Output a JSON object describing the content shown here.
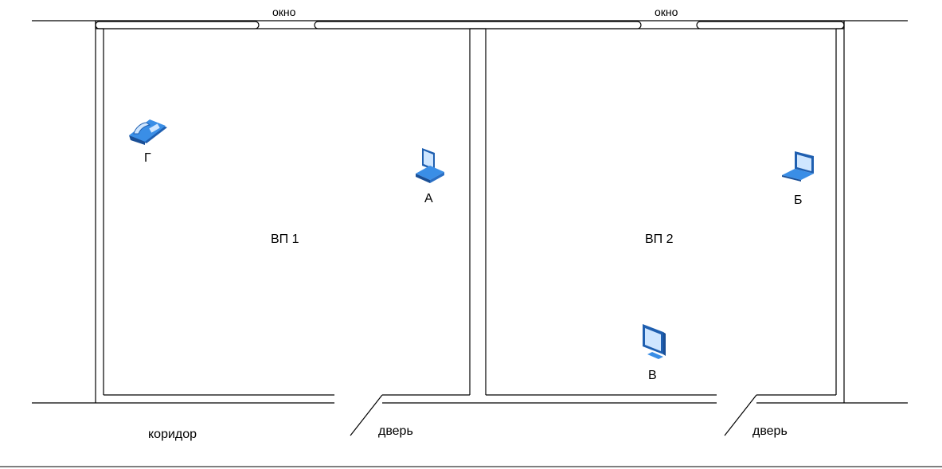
{
  "rooms": {
    "vp1": {
      "label": "ВП 1"
    },
    "vp2": {
      "label": "ВП 2"
    }
  },
  "windows": [
    {
      "label": "окно"
    },
    {
      "label": "окно"
    }
  ],
  "doors": [
    {
      "label": "дверь"
    },
    {
      "label": "дверь"
    }
  ],
  "corridor": {
    "label": "коридор"
  },
  "devices": {
    "phone": {
      "label": "Г",
      "icon": "telephone-icon"
    },
    "pc_a": {
      "label": "А",
      "icon": "desktop-computer-icon"
    },
    "laptop_b": {
      "label": "Б",
      "icon": "laptop-icon"
    },
    "monitor_v": {
      "label": "В",
      "icon": "monitor-icon"
    }
  },
  "colors": {
    "line": "#000000",
    "icon_blue": "#3a8ee6",
    "icon_dark": "#1f5fb0",
    "icon_light": "#cfe6ff"
  }
}
